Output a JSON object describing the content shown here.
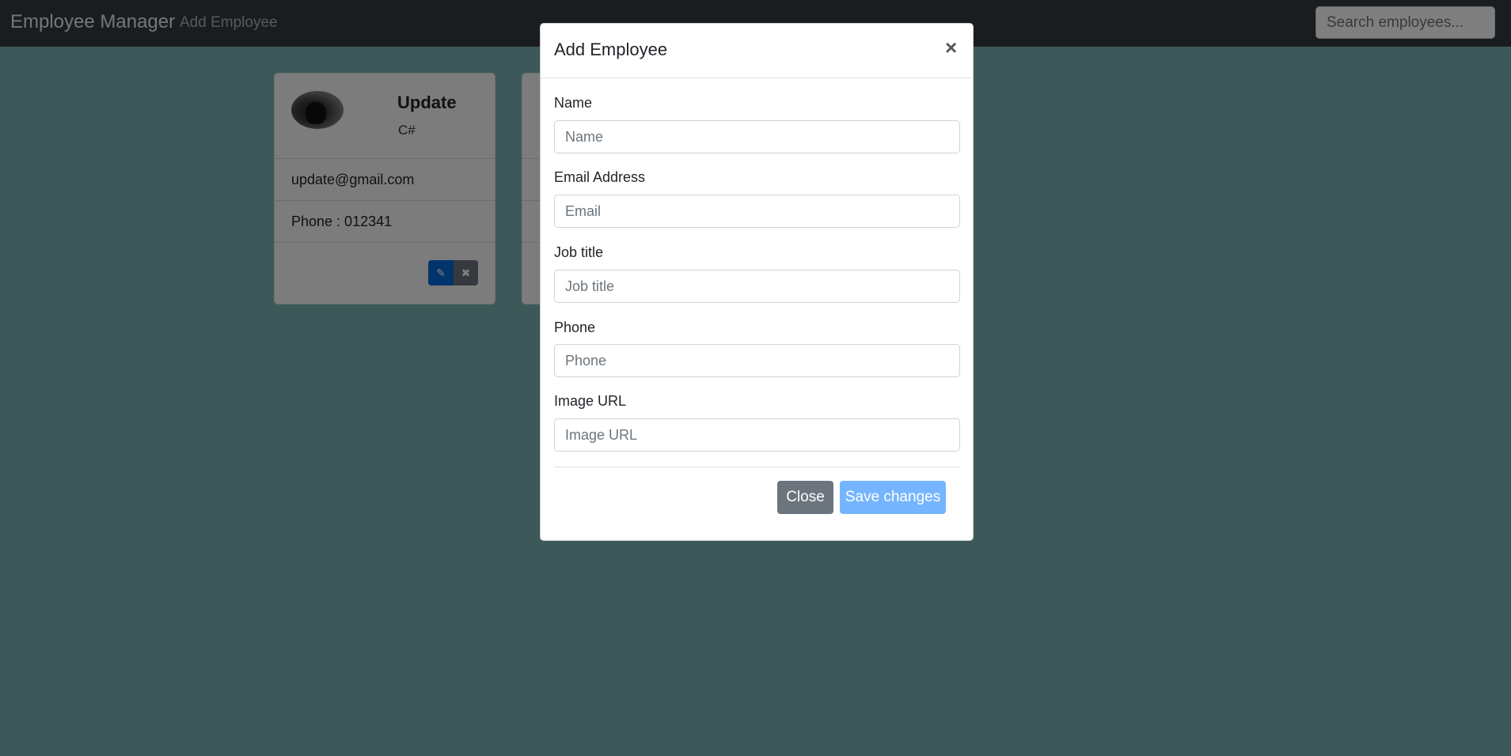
{
  "navbar": {
    "brand": "Employee Manager",
    "add_link": "Add Employee",
    "search_placeholder": "Search employees..."
  },
  "employees": [
    {
      "name": "Update",
      "job_title": "C#",
      "email": "update@gmail.com",
      "phone": "Phone : 012341"
    }
  ],
  "modal": {
    "title": "Add Employee",
    "close_symbol": "×",
    "fields": [
      {
        "label": "Name",
        "placeholder": "Name",
        "value": ""
      },
      {
        "label": "Email Address",
        "placeholder": "Email",
        "value": ""
      },
      {
        "label": "Job title",
        "placeholder": "Job title",
        "value": ""
      },
      {
        "label": "Phone",
        "placeholder": "Phone",
        "value": ""
      },
      {
        "label": "Image URL",
        "placeholder": "Image URL",
        "value": ""
      }
    ],
    "close_button": "Close",
    "save_button": "Save changes"
  },
  "icons": {
    "edit": "pencil-icon",
    "delete": "times-icon"
  },
  "colors": {
    "navbar_bg": "#343a40",
    "page_bg": "#7bb0b2",
    "primary": "#0069d9",
    "secondary": "#6c757d",
    "save_button": "#75b5ff"
  }
}
